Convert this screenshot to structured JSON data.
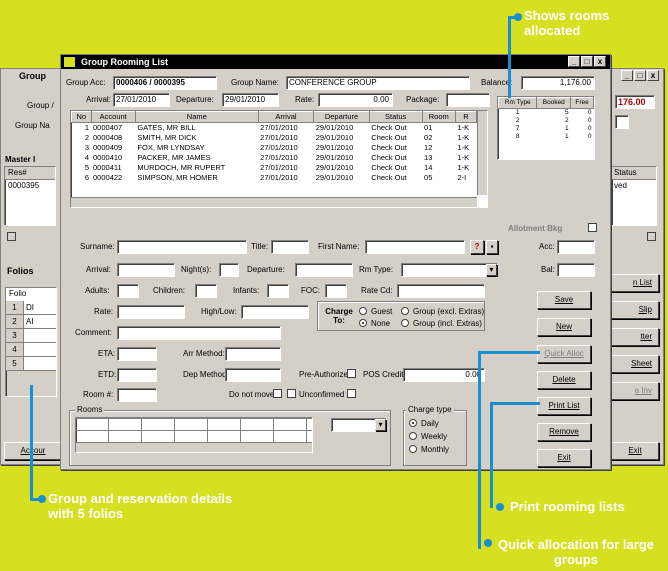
{
  "callouts": {
    "rooms_allocated": "Shows rooms allocated",
    "folios": "Group and reservation details with 5 folios",
    "print": "Print rooming lists",
    "quick_alloc": "Quick allocation for large groups"
  },
  "bg_window": {
    "title": "Group",
    "labels": {
      "group_a": "Group /",
      "group_n": "Group Na",
      "master": "Master I",
      "res": "Res#",
      "res_val": "0000395",
      "folios_tab": "Folios",
      "folio_hdr": "Folio",
      "accounts_btn": "Accour",
      "balance": "176.00",
      "status_hdr": "Status",
      "status_val": "ved",
      "exit": "Exit"
    },
    "folio_rows": [
      {
        "num": "1",
        "txt": "DI"
      },
      {
        "num": "2",
        "txt": "AI"
      },
      {
        "num": "3",
        "txt": ""
      },
      {
        "num": "4",
        "txt": ""
      },
      {
        "num": "5",
        "txt": ""
      }
    ],
    "right_btns": [
      "n List",
      "Slip",
      "tter",
      "Sheet",
      "a Inv"
    ]
  },
  "window": {
    "title": "Group Rooming List",
    "group_acc_label": "Group Acc:",
    "group_acc": "0000406 / 0000395",
    "group_name_label": "Group Name:",
    "group_name": "CONFERENCE GROUP",
    "balance_label": "Balance:",
    "balance": "1,176.00",
    "arrival_label": "Arrival:",
    "arrival": "27/01/2010",
    "departure_label": "Departure:",
    "departure": "29/01/2010",
    "rate_label": "Rate:",
    "rate": "0.00",
    "package_label": "Package:",
    "package": "",
    "res_columns": [
      "No",
      "Account",
      "Name",
      "Arrival",
      "Departure",
      "Status",
      "Room",
      "R"
    ],
    "res_rows": [
      [
        "1",
        "0000407",
        "GATES, MR BILL",
        "27/01/2010",
        "29/01/2010",
        "Check Out",
        "01",
        "1-K"
      ],
      [
        "2",
        "0000408",
        "SMITH, MR DICK",
        "27/01/2010",
        "29/01/2010",
        "Check Out",
        "02",
        "1-K"
      ],
      [
        "3",
        "0000409",
        "FOX, MR LYNDSAY",
        "27/01/2010",
        "29/01/2010",
        "Check Out",
        "12",
        "1-K"
      ],
      [
        "4",
        "0000410",
        "PACKER, MR JAMES",
        "27/01/2010",
        "29/01/2010",
        "Check Out",
        "13",
        "1-K"
      ],
      [
        "5",
        "0000411",
        "MURDOCH, MR RUPERT",
        "27/01/2010",
        "29/01/2010",
        "Check Out",
        "14",
        "1-K"
      ],
      [
        "6",
        "0000422",
        "SIMPSON, MR HOMER",
        "27/01/2010",
        "29/01/2010",
        "Check Out",
        "05",
        "2-I"
      ]
    ],
    "allot_columns": [
      "Rm Type",
      "Booked",
      "Free"
    ],
    "allot_rows": [
      [
        "1",
        "5",
        "0"
      ],
      [
        "2",
        "2",
        "0"
      ],
      [
        "7",
        "1",
        "0"
      ],
      [
        "8",
        "1",
        "0"
      ]
    ],
    "allotment_label": "Allotment Bkg",
    "form": {
      "surname": "Surname:",
      "title": "Title:",
      "first_name": "First Name:",
      "acc": "Acc:",
      "arrival": "Arrival:",
      "nights": "Night(s):",
      "departure": "Departure:",
      "rm_type": "Rm Type:",
      "bal": "Bal:",
      "adults": "Adults:",
      "children": "Children:",
      "infants": "Infants:",
      "foc": "FOC:",
      "rate_cd": "Rate Cd:",
      "rate": "Rate:",
      "high_low": "High/Low:",
      "comment": "Comment:",
      "eta": "ETA:",
      "arr_method": "Arr Method:",
      "etd": "ETD:",
      "dep_method": "Dep Method:",
      "pre_auth": "Pre-Authorized",
      "pos_credit": "POS Credit:",
      "pos_credit_val": "0.00",
      "room_no": "Room #:",
      "do_not_move": "Do not move",
      "unconfirmed": "Unconfirmed",
      "question": "?",
      "charge_to": "Charge To:",
      "guest": "Guest",
      "group_excl": "Group (excl. Extras)",
      "none": "None",
      "group_incl": "Group (incl. Extras)",
      "rooms": "Rooms",
      "charge_type": "Charge type",
      "daily": "Daily",
      "weekly": "Weekly",
      "monthly": "Monthly"
    },
    "buttons": {
      "save": "Save",
      "new": "New",
      "quick_alloc": "Quick Alloc",
      "delete": "Delete",
      "print_list": "Print List",
      "remove": "Remove",
      "exit": "Exit"
    }
  },
  "colors": {
    "background": "#d6e021",
    "callout_line": "#1a8fd0",
    "window_face": "#d4d0c8",
    "title_bar": "#000000",
    "balance_red": "#b00000"
  }
}
